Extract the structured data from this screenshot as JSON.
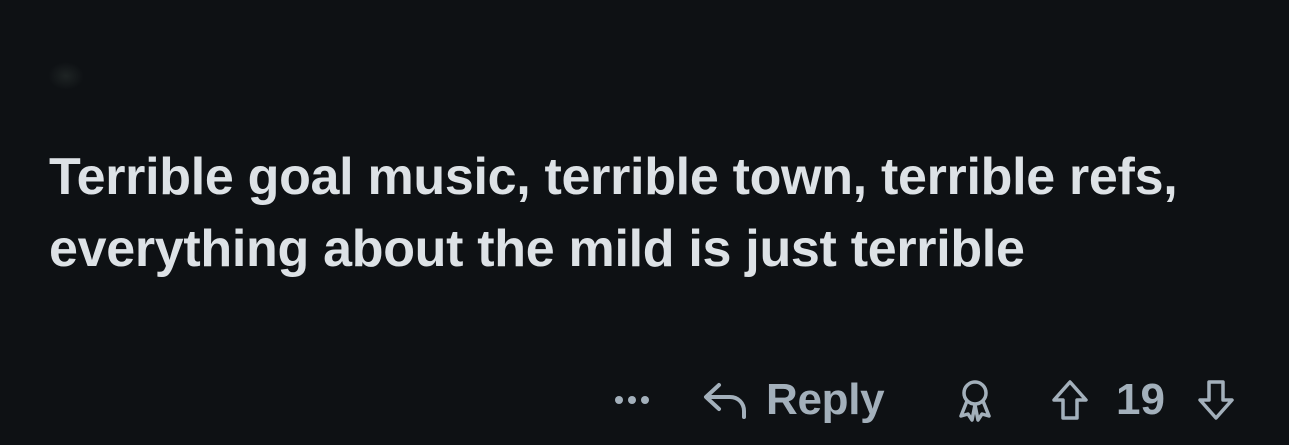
{
  "comment": {
    "body": "Terrible goal music, terrible town, terrible refs, everything about the mild is just terrible"
  },
  "actions": {
    "more_icon": "ellipsis-icon",
    "reply_icon": "reply-arrow-icon",
    "reply_label": "Reply",
    "award_icon": "award-icon",
    "upvote_icon": "upvote-arrow-icon",
    "score": "19",
    "downvote_icon": "downvote-arrow-icon"
  },
  "colors": {
    "background": "#0e1114",
    "text": "#dde2e6",
    "muted": "#a3b0bb"
  }
}
